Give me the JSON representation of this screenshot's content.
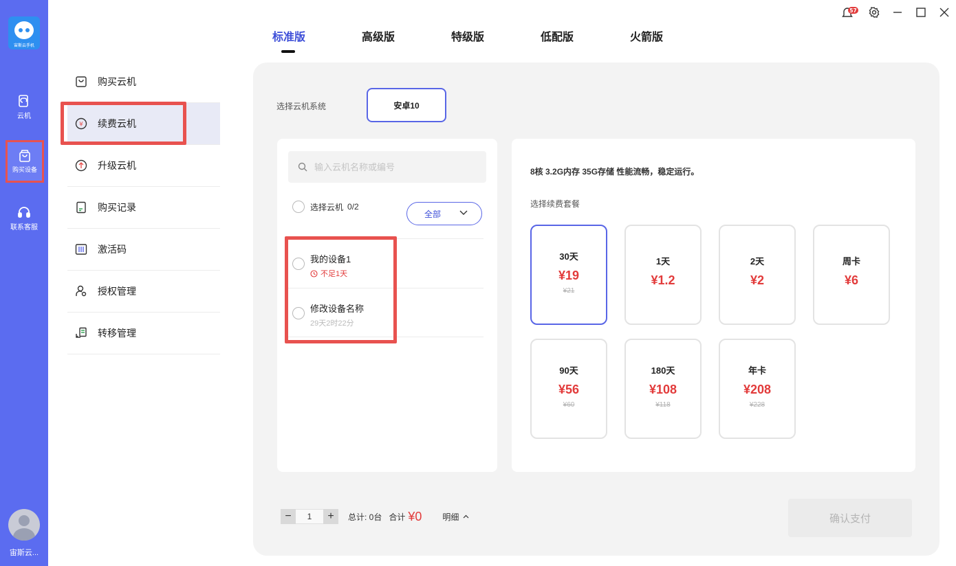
{
  "app": {
    "logo_text": "宙斯云手机",
    "user_name": "宙斯云..."
  },
  "rail": [
    {
      "label": "云机",
      "icon": "cloud-phone-icon"
    },
    {
      "label": "购买设备",
      "icon": "shopping-bag-icon",
      "active": true
    },
    {
      "label": "联系客服",
      "icon": "headset-icon"
    }
  ],
  "menu": [
    {
      "label": "购买云机",
      "icon": "bag-icon"
    },
    {
      "label": "续费云机",
      "icon": "yen-circle-icon",
      "active": true
    },
    {
      "label": "升级云机",
      "icon": "arrow-up-circle-icon"
    },
    {
      "label": "购买记录",
      "icon": "document-icon"
    },
    {
      "label": "激活码",
      "icon": "barcode-icon"
    },
    {
      "label": "授权管理",
      "icon": "user-key-icon"
    },
    {
      "label": "转移管理",
      "icon": "transfer-icon"
    }
  ],
  "tabs": [
    {
      "label": "标准版",
      "active": true
    },
    {
      "label": "高级版"
    },
    {
      "label": "特级版"
    },
    {
      "label": "低配版"
    },
    {
      "label": "火箭版"
    }
  ],
  "notification_badge": "57",
  "os": {
    "label": "选择云机系统",
    "selected": "安卓10"
  },
  "search": {
    "placeholder": "输入云机名称或编号"
  },
  "device_select": {
    "label": "选择云机",
    "count": "0/2",
    "filter": "全部"
  },
  "devices": [
    {
      "name": "我的设备1",
      "status": "不足1天",
      "warn": true
    },
    {
      "name": "修改设备名称",
      "status": "29天2时22分",
      "warn": false
    }
  ],
  "spec": "8核 3.2G内存 35G存储 性能流畅，稳定运行。",
  "package_label": "选择续费套餐",
  "packages": [
    {
      "name": "30天",
      "price": "¥19",
      "old": "¥21",
      "selected": true
    },
    {
      "name": "1天",
      "price": "¥1.2",
      "old": ""
    },
    {
      "name": "2天",
      "price": "¥2",
      "old": ""
    },
    {
      "name": "周卡",
      "price": "¥6",
      "old": ""
    },
    {
      "name": "90天",
      "price": "¥56",
      "old": "¥60"
    },
    {
      "name": "180天",
      "price": "¥108",
      "old": "¥118"
    },
    {
      "name": "年卡",
      "price": "¥208",
      "old": "¥228"
    }
  ],
  "bottom": {
    "minus": "−",
    "plus": "+",
    "quantity": "1",
    "total": "总计: 0台",
    "sum_label": "合计",
    "sum_value": "¥0",
    "detail": "明细",
    "pay": "确认支付"
  },
  "colors": {
    "accent": "#5865e6",
    "rail": "#5b6cf0",
    "price": "#e23b3b",
    "highlight": "#e8524f"
  }
}
